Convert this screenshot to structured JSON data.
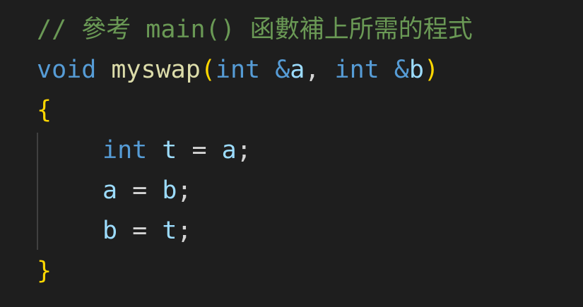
{
  "code": {
    "line1": {
      "comment": "// 參考 main() 函數補上所需的程式"
    },
    "line2": {
      "ret_type": "void",
      "func_name": "myswap",
      "open_paren": "(",
      "param1_type": "int",
      "param1_amp": "&",
      "param1_name": "a",
      "comma": ",",
      "param2_type": "int",
      "param2_amp": "&",
      "param2_name": "b",
      "close_paren": ")"
    },
    "line3": {
      "open_brace": "{"
    },
    "line4": {
      "type": "int",
      "var": "t",
      "op": "=",
      "value": "a",
      "semi": ";"
    },
    "line5": {
      "var": "a",
      "op": "=",
      "value": "b",
      "semi": ";"
    },
    "line6": {
      "var": "b",
      "op": "=",
      "value": "t",
      "semi": ";"
    },
    "line7": {
      "close_brace": "}"
    }
  },
  "colors": {
    "background": "#1e1e1e",
    "comment": "#6a9955",
    "keyword": "#569cd6",
    "function": "#dcdcaa",
    "variable": "#9cdcfe",
    "bracket": "#ffd700",
    "text": "#d4d4d4"
  }
}
